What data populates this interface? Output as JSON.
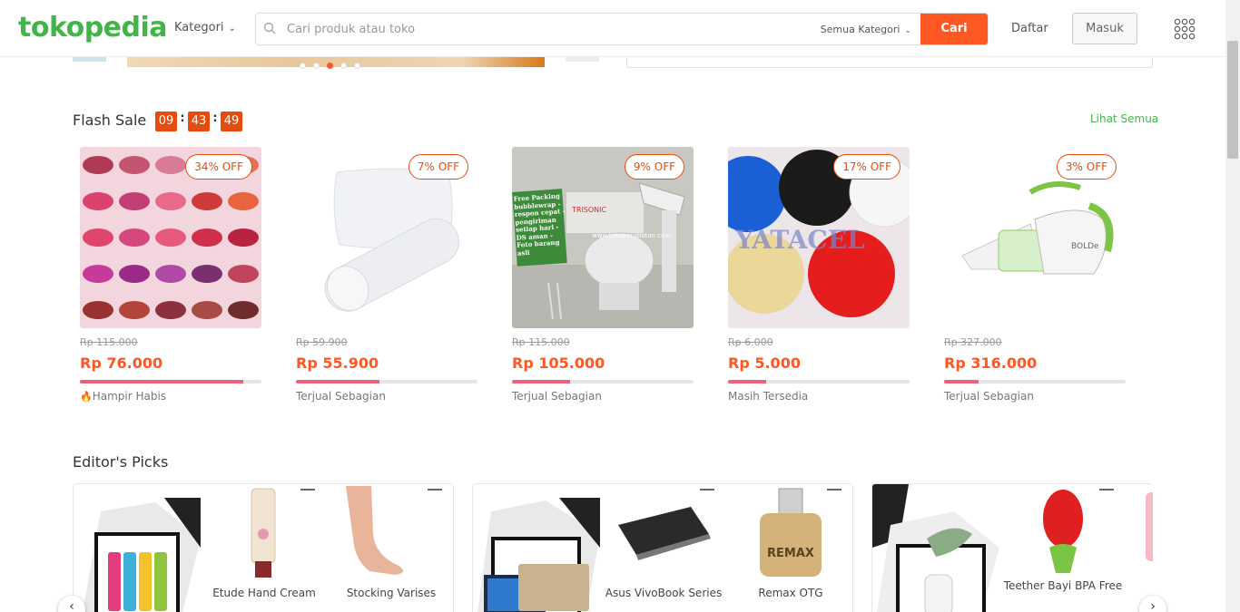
{
  "header": {
    "logo": "tokopedia",
    "kategori": "Kategori",
    "search_placeholder": "Cari produk atau toko",
    "search_category": "Semua Kategori",
    "search_button": "Cari",
    "daftar": "Daftar",
    "masuk": "Masuk",
    "icons": {
      "search": "search-icon",
      "chevron": "chevron-down-icon",
      "apps": "grid-icon"
    }
  },
  "colors": {
    "brand_green": "#42b549",
    "accent_orange": "#ff5722",
    "timer_red": "#e74c0f",
    "stock_bar": "#f0607a"
  },
  "flash_sale": {
    "title": "Flash Sale",
    "timer": {
      "hours": "09",
      "minutes": "43",
      "seconds": "49",
      "separator": ":"
    },
    "see_all": "Lihat Semua",
    "products": [
      {
        "discount": "34% OFF",
        "old_price": "Rp 115.000",
        "price": "Rp 76.000",
        "stock_sold": 0.9,
        "status": "Hampir Habis",
        "hot": true
      },
      {
        "discount": "7% OFF",
        "old_price": "Rp 59.900",
        "price": "Rp 55.900",
        "stock_sold": 0.46,
        "status": "Terjual Sebagian",
        "hot": false
      },
      {
        "discount": "9% OFF",
        "old_price": "Rp 115.000",
        "price": "Rp 105.000",
        "stock_sold": 0.32,
        "status": "Terjual Sebagian",
        "hot": false
      },
      {
        "discount": "17% OFF",
        "old_price": "Rp 6.000",
        "price": "Rp 5.000",
        "stock_sold": 0.21,
        "status": "Masih Tersedia",
        "hot": false
      },
      {
        "discount": "3% OFF",
        "old_price": "Rp 327.000",
        "price": "Rp 316.000",
        "stock_sold": 0.19,
        "status": "Terjual Sebagian",
        "hot": false
      }
    ],
    "image_texts": {
      "mixer_sticker": "Free Packing bubblewrap - respon cepat - pengiriman setiap hari - DS aman - Foto barang asli",
      "mixer_brand": "TRISONIC",
      "mixer_url": "www.tokoperabotan.com",
      "vacuum_brand": "BOLDe",
      "lids_watermark": "YATACEL"
    }
  },
  "editors_picks": {
    "title": "Editor's Picks",
    "cards": [
      {
        "items": [
          "Etude Hand Cream",
          "Stocking Varises"
        ]
      },
      {
        "items": [
          "Asus VivoBook Series",
          "Remax OTG"
        ]
      },
      {
        "items": [
          "Teether Bayi BPA Free"
        ]
      }
    ],
    "remax_logo": "REMAX"
  }
}
